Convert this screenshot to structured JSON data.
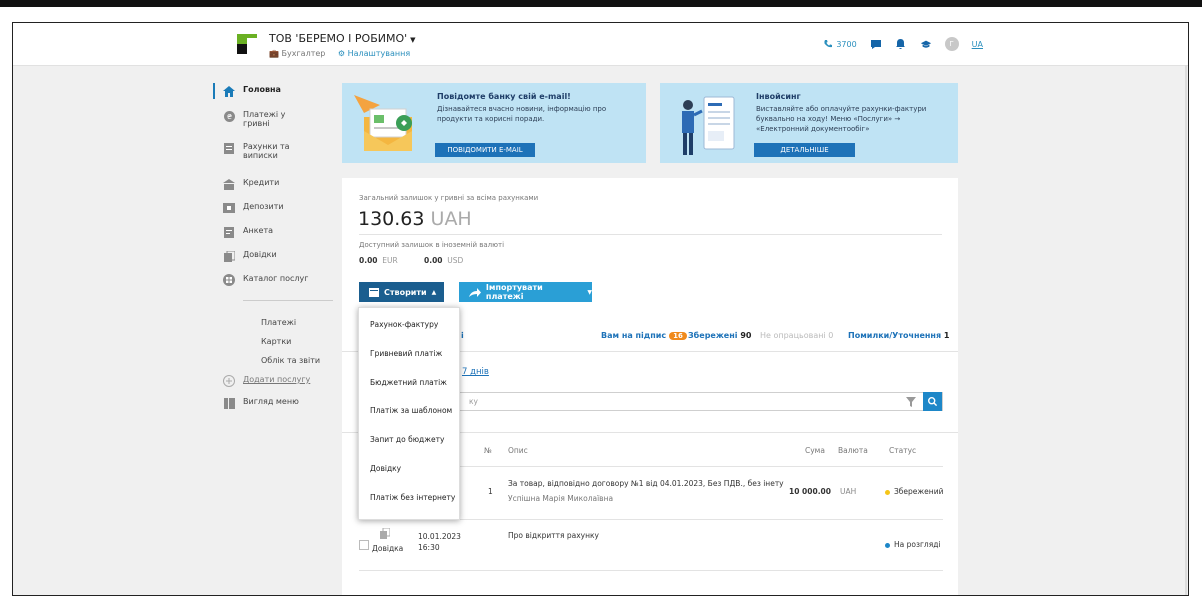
{
  "header": {
    "company": "ТОВ 'БЕРЕМО І РОБИМО'",
    "role": "Бухгалтер",
    "settings": "Налаштування",
    "phone": "3700",
    "avatar_letter": "Г",
    "lang": "UA"
  },
  "sidebar": {
    "items": [
      {
        "label": "Головна",
        "icon": "home-icon"
      },
      {
        "label": "Платежі у гривні",
        "icon": "hryvnia-icon"
      },
      {
        "label": "Рахунки та виписки",
        "icon": "statement-icon"
      },
      {
        "label": "Кредити",
        "icon": "credit-icon"
      },
      {
        "label": "Депозити",
        "icon": "deposit-icon"
      },
      {
        "label": "Анкета",
        "icon": "form-icon"
      },
      {
        "label": "Довідки",
        "icon": "certificate-icon"
      },
      {
        "label": "Каталог послуг",
        "icon": "catalog-icon"
      }
    ],
    "sub_items": [
      "Платежі",
      "Картки",
      "Облік та звіти"
    ],
    "add_service": "Додати послугу",
    "menu_view": "Вигляд меню"
  },
  "banners": {
    "email": {
      "title": "Повідомте банку свій e-mail!",
      "text": "Дізнавайтеся вчасно новини, інформацію про продукти та корисні поради.",
      "button": "ПОВІДОМИТИ E-MAIL"
    },
    "invoicing": {
      "title": "Інвойсинг",
      "text": "Виставляйте або оплачуйте рахунки-фактури буквально на ходу! Меню «Послуги» → «Електронний документообіг»",
      "button": "ДЕТАЛЬНІШЕ"
    }
  },
  "balance": {
    "label": "Загальний залишок у гривні за всіма рахунками",
    "amount": "130.63",
    "currency": "UAH",
    "fx_label": "Доступний залишок в іноземній валюті",
    "eur_amount": "0.00",
    "eur": "EUR",
    "usd_amount": "0.00",
    "usd": "USD"
  },
  "actions": {
    "create": "Створити",
    "import": "Імпортувати платежі"
  },
  "tabs": {
    "partial_left": "і",
    "to_sign": "Вам на підпис",
    "to_sign_count": "16",
    "saved": "Збережені",
    "saved_count": "90",
    "unprocessed": "Не опрацьовані",
    "unprocessed_count": "0",
    "errors": "Помилки/Уточнення",
    "errors_count": "1"
  },
  "filter": {
    "period_partial": "7 днів",
    "search_partial": "ку"
  },
  "table": {
    "headers": {
      "num": "№",
      "desc": "Опис",
      "sum": "Сума",
      "currency": "Валюта",
      "status": "Статус"
    },
    "rows": [
      {
        "num": "1",
        "desc": "За товар, відповідно договору №1 від 04.01.2023, Без ПДВ., без інету",
        "payer": "Успішна Марія Миколаївна",
        "sum": "10 000.00",
        "currency": "UAH",
        "status": "Збережений",
        "status_color": "#f5c518"
      },
      {
        "type": "Довідка",
        "date": "10.01.2023",
        "time": "16:30",
        "desc": "Про відкриття рахунку",
        "status": "На розгляді",
        "status_color": "#1d87c8"
      }
    ]
  },
  "dropdown": {
    "items": [
      "Рахунок-фактуру",
      "Гривневий платіж",
      "Бюджетний платіж",
      "Платіж за шаблоном",
      "Запит до бюджету",
      "Довідку",
      "Платіж без інтернету"
    ]
  }
}
